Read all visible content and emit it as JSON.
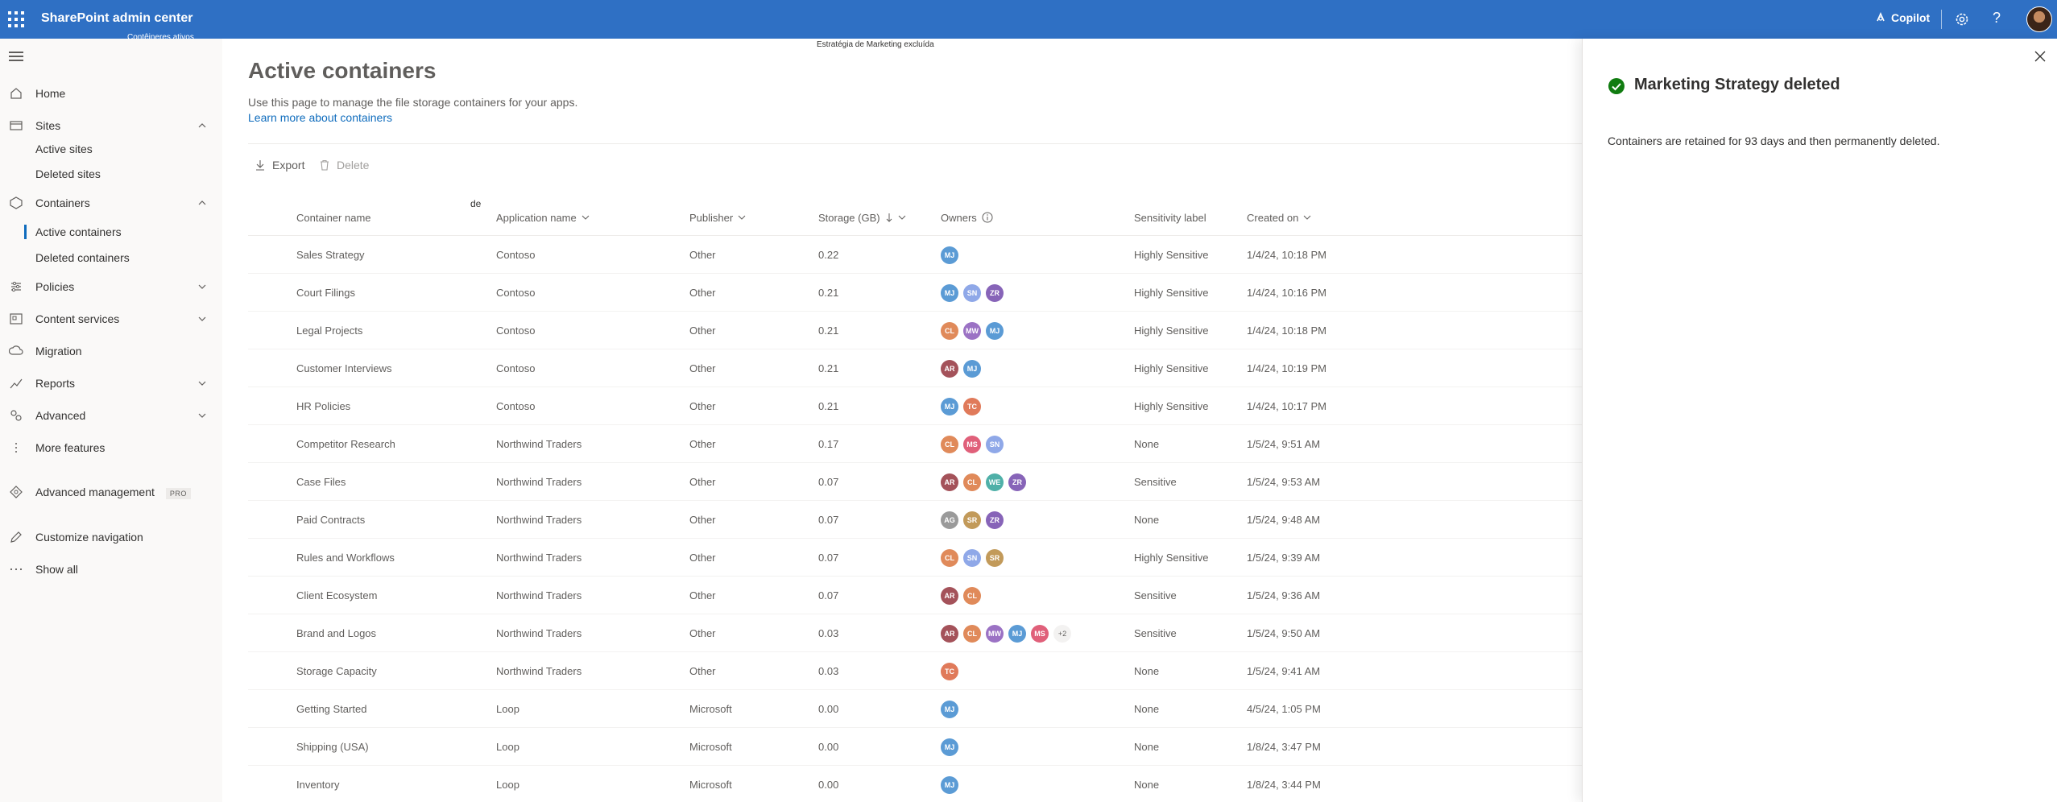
{
  "app": {
    "title": "SharePoint admin center",
    "subtitle_overlay": "Contêineres ativos",
    "copilot_label": "Copilot"
  },
  "sidebar": {
    "items": [
      {
        "label": "Home",
        "icon": "home-icon"
      },
      {
        "label": "Sites",
        "icon": "sites-icon",
        "expanded": true
      },
      {
        "label": "Active sites",
        "sub": true
      },
      {
        "label": "Deleted sites",
        "sub": true
      },
      {
        "label": "Containers",
        "icon": "containers-icon",
        "expanded": true
      },
      {
        "label": "Active containers",
        "sub": true,
        "active": true
      },
      {
        "label": "Deleted containers",
        "sub": true
      },
      {
        "label": "Policies",
        "icon": "policies-icon",
        "expanded": false
      },
      {
        "label": "Content services",
        "icon": "content-services-icon",
        "expanded": false
      },
      {
        "label": "Migration",
        "icon": "migration-icon"
      },
      {
        "label": "Reports",
        "icon": "reports-icon",
        "expanded": false
      },
      {
        "label": "Advanced",
        "icon": "advanced-icon",
        "expanded": false
      },
      {
        "label": "More features",
        "icon": "more-features-icon"
      },
      {
        "label": "Advanced management",
        "icon": "advanced-management-icon",
        "badge": "PRO"
      },
      {
        "label": "Customize navigation",
        "icon": "pencil-icon"
      },
      {
        "label": "Show all",
        "icon": "ellipsis-icon"
      }
    ]
  },
  "main": {
    "toast_text": "Estratégia de Marketing excluída",
    "title": "Active containers",
    "description": "Use this page to manage the file storage containers for your apps.",
    "learn_more": "Learn more about containers",
    "stray_text": "de",
    "commands": {
      "export": "Export",
      "delete": "Delete"
    },
    "columns": {
      "name": "Container name",
      "app": "Application name",
      "publisher": "Publisher",
      "storage": "Storage (GB)",
      "owners": "Owners",
      "sensitivity": "Sensitivity label",
      "created": "Created on"
    },
    "rows": [
      {
        "name": "Sales Strategy",
        "app": "Contoso",
        "publisher": "Other",
        "storage": "0.22",
        "owners": [
          "MJ"
        ],
        "sensitivity": "Highly Sensitive",
        "created": "1/4/24, 10:18 PM"
      },
      {
        "name": "Court Filings",
        "app": "Contoso",
        "publisher": "Other",
        "storage": "0.21",
        "owners": [
          "MJ",
          "SN",
          "ZR"
        ],
        "sensitivity": "Highly Sensitive",
        "created": "1/4/24, 10:16 PM"
      },
      {
        "name": "Legal Projects",
        "app": "Contoso",
        "publisher": "Other",
        "storage": "0.21",
        "owners": [
          "CL",
          "MW",
          "MJ"
        ],
        "sensitivity": "Highly Sensitive",
        "created": "1/4/24, 10:18 PM"
      },
      {
        "name": "Customer Interviews",
        "app": "Contoso",
        "publisher": "Other",
        "storage": "0.21",
        "owners": [
          "AR",
          "MJ"
        ],
        "sensitivity": "Highly Sensitive",
        "created": "1/4/24, 10:19 PM"
      },
      {
        "name": "HR Policies",
        "app": "Contoso",
        "publisher": "Other",
        "storage": "0.21",
        "owners": [
          "MJ",
          "TC"
        ],
        "sensitivity": "Highly Sensitive",
        "created": "1/4/24, 10:17 PM"
      },
      {
        "name": "Competitor Research",
        "app": "Northwind Traders",
        "publisher": "Other",
        "storage": "0.17",
        "owners": [
          "CL",
          "MS",
          "SN"
        ],
        "sensitivity": "None",
        "created": "1/5/24, 9:51 AM"
      },
      {
        "name": "Case Files",
        "app": "Northwind Traders",
        "publisher": "Other",
        "storage": "0.07",
        "owners": [
          "AR",
          "CL",
          "WE",
          "ZR"
        ],
        "sensitivity": "Sensitive",
        "created": "1/5/24, 9:53 AM"
      },
      {
        "name": "Paid Contracts",
        "app": "Northwind Traders",
        "publisher": "Other",
        "storage": "0.07",
        "owners": [
          "AG",
          "SR",
          "ZR"
        ],
        "sensitivity": "None",
        "created": "1/5/24, 9:48 AM"
      },
      {
        "name": "Rules and Workflows",
        "app": "Northwind Traders",
        "publisher": "Other",
        "storage": "0.07",
        "owners": [
          "CL",
          "SN",
          "SR"
        ],
        "sensitivity": "Highly Sensitive",
        "created": "1/5/24, 9:39 AM"
      },
      {
        "name": "Client Ecosystem",
        "app": "Northwind Traders",
        "publisher": "Other",
        "storage": "0.07",
        "owners": [
          "AR",
          "CL"
        ],
        "sensitivity": "Sensitive",
        "created": "1/5/24, 9:36 AM"
      },
      {
        "name": "Brand and Logos",
        "app": "Northwind Traders",
        "publisher": "Other",
        "storage": "0.03",
        "owners": [
          "AR",
          "CL",
          "MW",
          "MJ",
          "MS"
        ],
        "more_owners": "+2",
        "sensitivity": "Sensitive",
        "created": "1/5/24, 9:50 AM"
      },
      {
        "name": "Storage Capacity",
        "app": "Northwind Traders",
        "publisher": "Other",
        "storage": "0.03",
        "owners": [
          "TC"
        ],
        "sensitivity": "None",
        "created": "1/5/24, 9:41 AM"
      },
      {
        "name": "Getting Started",
        "app": "Loop",
        "publisher": "Microsoft",
        "storage": "0.00",
        "owners": [
          "MJ"
        ],
        "sensitivity": "None",
        "created": "4/5/24, 1:05 PM"
      },
      {
        "name": "Shipping (USA)",
        "app": "Loop",
        "publisher": "Microsoft",
        "storage": "0.00",
        "owners": [
          "MJ"
        ],
        "sensitivity": "None",
        "created": "1/8/24, 3:47 PM"
      },
      {
        "name": "Inventory",
        "app": "Loop",
        "publisher": "Microsoft",
        "storage": "0.00",
        "owners": [
          "MJ"
        ],
        "sensitivity": "None",
        "created": "1/8/24, 3:44 PM"
      }
    ]
  },
  "avatar_colors": {
    "MJ": "#5b9bd5",
    "SN": "#8fa8e8",
    "ZR": "#8764b8",
    "CL": "#e08a5a",
    "MW": "#9b72c4",
    "AR": "#a4525a",
    "TC": "#e07a5a",
    "MS": "#e0607a",
    "WE": "#4fb0a8",
    "AG": "#9a9a9a",
    "SR": "#c29a5a"
  },
  "panel": {
    "title": "Marketing Strategy deleted",
    "body": "Containers are retained for 93 days and then permanently deleted.",
    "success_color": "#107c10"
  },
  "colors": {
    "topbar": "#2f70c4",
    "link": "#0f6cbd"
  }
}
